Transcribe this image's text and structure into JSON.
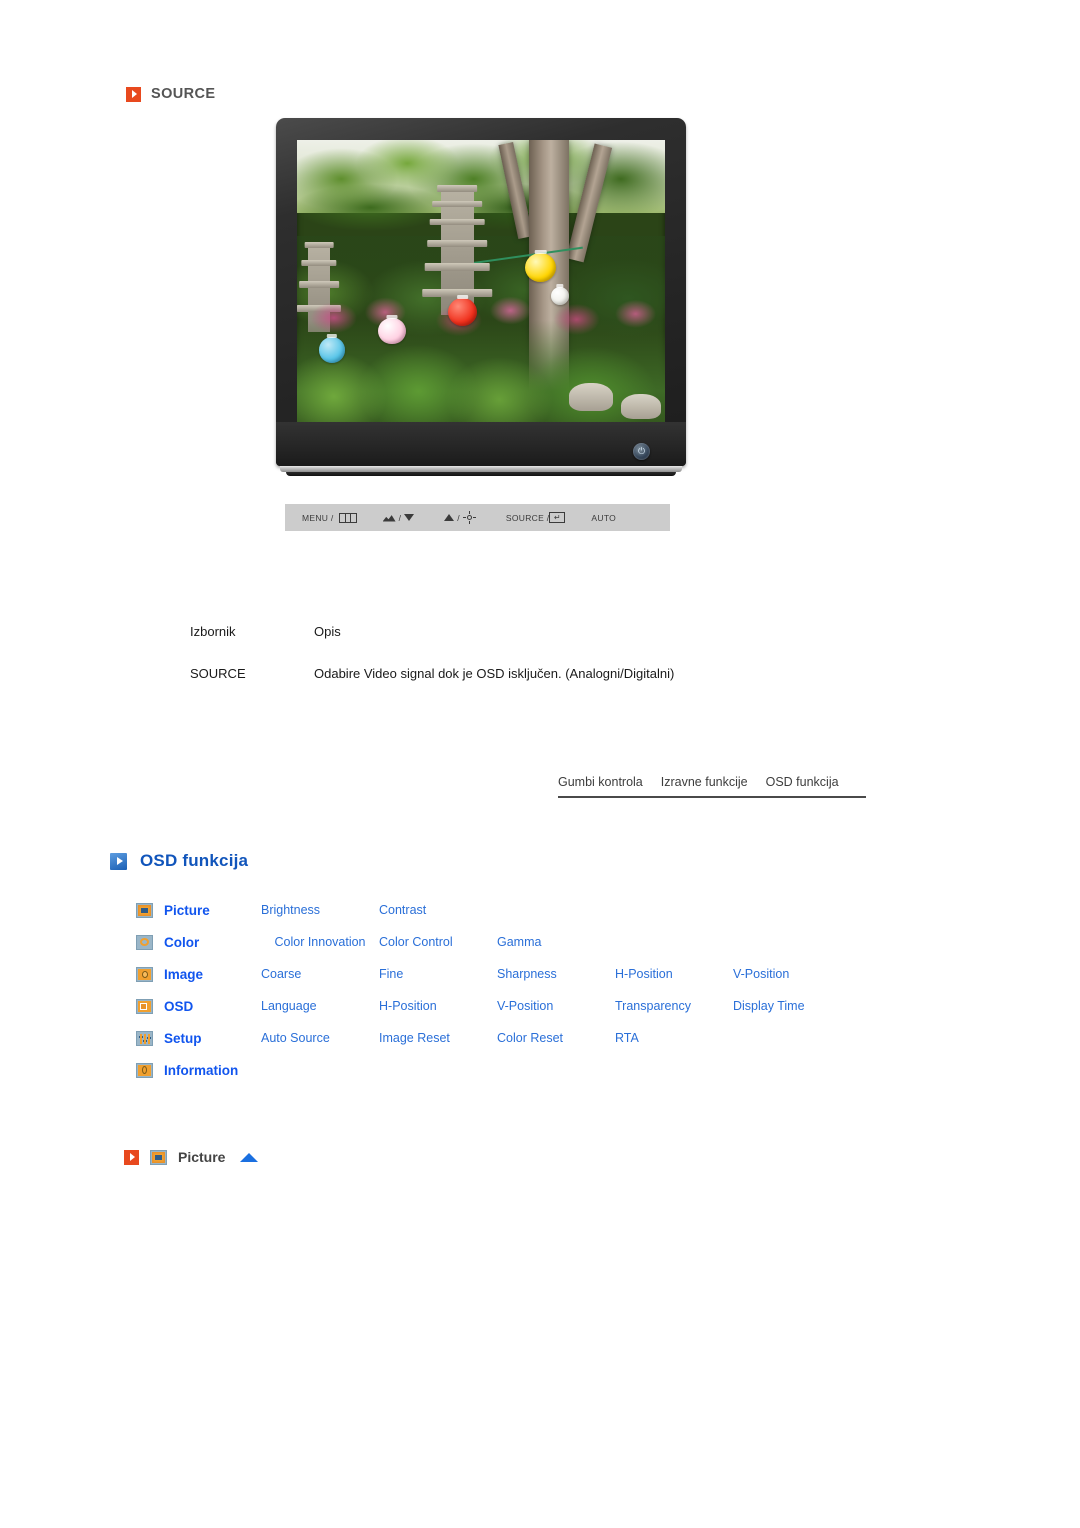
{
  "source_section": {
    "icon": "orange-play-marker-icon",
    "title": "SOURCE"
  },
  "monitor": {
    "alt": "lcd-monitor-photo",
    "power_glyph": "⏻",
    "control_bar": {
      "buttons": [
        {
          "label": "MENU /",
          "icon": "menu-bars-icon"
        },
        {
          "label": "/",
          "icon": "contrast-down-icon"
        },
        {
          "label": "/",
          "icon": "brightness-up-icon"
        },
        {
          "label": "SOURCE /",
          "icon": "enter-key-icon"
        },
        {
          "label": "AUTO",
          "icon": "auto-adjust-icon"
        }
      ]
    }
  },
  "description_table": {
    "headers": {
      "menu": "Izbornik",
      "desc": "Opis"
    },
    "rows": [
      {
        "menu": "SOURCE",
        "desc": "Odabire Video signal dok je OSD isključen. (Analogni/Digitalni)"
      }
    ]
  },
  "tabs": [
    {
      "label": "Gumbi kontrola"
    },
    {
      "label": "Izravne funkcije"
    },
    {
      "label": "OSD funkcija"
    }
  ],
  "osd_section": {
    "icon": "blue-play-marker-icon",
    "title": "OSD funkcija",
    "menu_map": [
      {
        "icon": "picture-icon",
        "category": "Picture",
        "items": [
          "Brightness",
          "Contrast"
        ]
      },
      {
        "icon": "color-icon",
        "category": "Color",
        "items": [
          "Color Innovation",
          "Color Control",
          "Gamma"
        ]
      },
      {
        "icon": "image-icon",
        "category": "Image",
        "items": [
          "Coarse",
          "Fine",
          "Sharpness",
          "H-Position",
          "V-Position"
        ]
      },
      {
        "icon": "osd-icon",
        "category": "OSD",
        "items": [
          "Language",
          "H-Position",
          "V-Position",
          "Transparency",
          "Display Time"
        ]
      },
      {
        "icon": "setup-icon",
        "category": "Setup",
        "items": [
          "Auto Source",
          "Image Reset",
          "Color Reset",
          "RTA"
        ]
      },
      {
        "icon": "information-icon",
        "category": "Information",
        "items": []
      }
    ]
  },
  "picture_section": {
    "marker_icon": "orange-play-marker-icon",
    "icon": "picture-icon",
    "title": "Picture",
    "back_to_top_icon": "blue-up-triangle-icon"
  },
  "colors": {
    "orange_marker": "#e8491e",
    "blue_marker": "#1a5fb4",
    "heading_blue": "#1155bb",
    "link_blue": "#2a6fd8",
    "category_blue": "#1155ee",
    "control_bar_bg": "#cccccc",
    "icon_orange": "#f0a030"
  }
}
